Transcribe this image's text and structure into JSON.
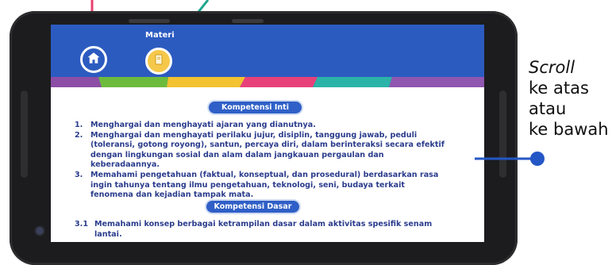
{
  "header": {
    "materi_label": "Materi"
  },
  "icons": {
    "home": "home-icon",
    "materi": "book-icon"
  },
  "stripe_colors": [
    "#8d4ea6",
    "#6dbb3d",
    "#f2c230",
    "#e8417a",
    "#2bb3a7",
    "#9056b0"
  ],
  "kompetensi_inti": {
    "title": "Kompetensi Inti",
    "items": [
      {
        "num": "1.",
        "text": "Menghargai dan menghayati ajaran yang dianutnya."
      },
      {
        "num": "2.",
        "text": "Menghargai dan menghayati perilaku jujur, disiplin, tanggung jawab, peduli (toleransi, gotong royong), santun, percaya diri, dalam berinteraksi secara efektif dengan lingkungan sosial dan alam dalam jangkauan pergaulan dan keberadaannya."
      },
      {
        "num": "3.",
        "text": "Memahami pengetahuan (faktual, konseptual, dan prosedural) berdasarkan rasa ingin tahunya tentang ilmu pengetahuan, teknologi, seni, budaya terkait fenomena dan kejadian tampak mata."
      }
    ]
  },
  "kompetensi_dasar": {
    "title": "Kompetensi Dasar",
    "items": [
      {
        "num": "3.1",
        "text": "Memahami konsep berbagai ketrampilan dasar dalam aktivitas spesifik senam lantai."
      }
    ]
  },
  "annotation": {
    "line1": "Scroll",
    "line2": "ke atas",
    "line3": "atau",
    "line4": "ke bawah"
  },
  "colors": {
    "header_blue": "#2c5bc0",
    "text_navy": "#2a3c8c",
    "callout_pink": "#e8416f",
    "callout_teal": "#1fa58e",
    "callout_blue": "#2457c5"
  }
}
